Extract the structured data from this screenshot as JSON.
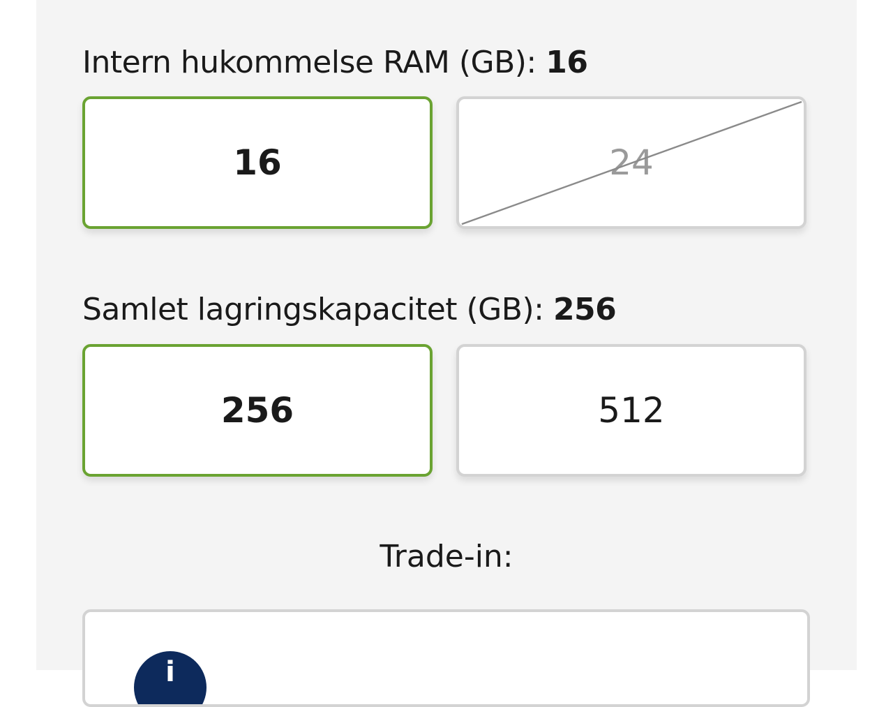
{
  "ram": {
    "label": "Intern hukommelse RAM (GB):",
    "selected_value": "16",
    "options": [
      {
        "label": "16",
        "state": "selected"
      },
      {
        "label": "24",
        "state": "unavailable"
      }
    ]
  },
  "storage": {
    "label": "Samlet lagringskapacitet (GB):",
    "selected_value": "256",
    "options": [
      {
        "label": "256",
        "state": "selected"
      },
      {
        "label": "512",
        "state": "available"
      }
    ]
  },
  "trade_in": {
    "title": "Trade-in:",
    "info_icon": "info-icon"
  },
  "colors": {
    "selected_border": "#6aa332",
    "default_border": "#d3d3d3",
    "panel_background": "#f4f4f4",
    "info_icon_background": "#0d2a5c"
  }
}
